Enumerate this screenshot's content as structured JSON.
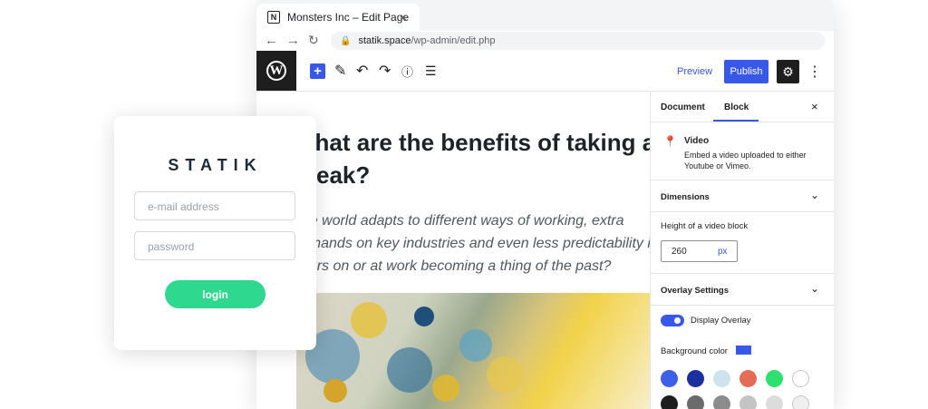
{
  "browser": {
    "tab_title": "Monsters Inc – Edit Page",
    "tab_close": "×",
    "favicon": "N",
    "url_host": "statik.space",
    "url_path": "/wp-admin/edit.php",
    "icons": {
      "back": "back-arrow-icon",
      "forward": "forward-arrow-icon",
      "reload": "reload-icon",
      "lock": "lock-icon"
    }
  },
  "toolbar": {
    "logo": "W",
    "add": "+",
    "preview_label": "Preview",
    "publish_label": "Publish",
    "accent_color": "#3858e9"
  },
  "content": {
    "heading": "What are the benefits of taking a break?",
    "paragraph": "The world adapts to different ways of working, extra demands on key industries and even less predictability in hours on or at work becoming a thing of the past?"
  },
  "sidebar": {
    "tabs": [
      "Document",
      "Block"
    ],
    "active_tab": "Block",
    "close": "×",
    "block": {
      "title": "Video",
      "description": "Embed a video uploaded to either Youtube or Vimeo."
    },
    "dimensions": {
      "title": "Dimensions",
      "height_label": "Height of a video block",
      "height_value": "260",
      "unit": "px"
    },
    "overlay": {
      "title": "Overlay Settings",
      "toggle_label": "Display Overlay",
      "toggle_on": true,
      "bg_label": "Background color",
      "bg_color": "#3858e9",
      "palette_row1": [
        "#3e5fe8",
        "#1c2f9e",
        "#cfe3ec",
        "#e46b56",
        "#2ee06f",
        "#ffffff"
      ],
      "palette_row2": [
        "#1e1e1e",
        "#6b6b6b",
        "#8c8c8c",
        "#c4c4c4",
        "#dcdcdc",
        "#efefef"
      ]
    }
  },
  "login": {
    "logo": "STATIK",
    "email_placeholder": "e-mail address",
    "password_placeholder": "password",
    "button_label": "login",
    "button_color": "#2ed88f"
  }
}
